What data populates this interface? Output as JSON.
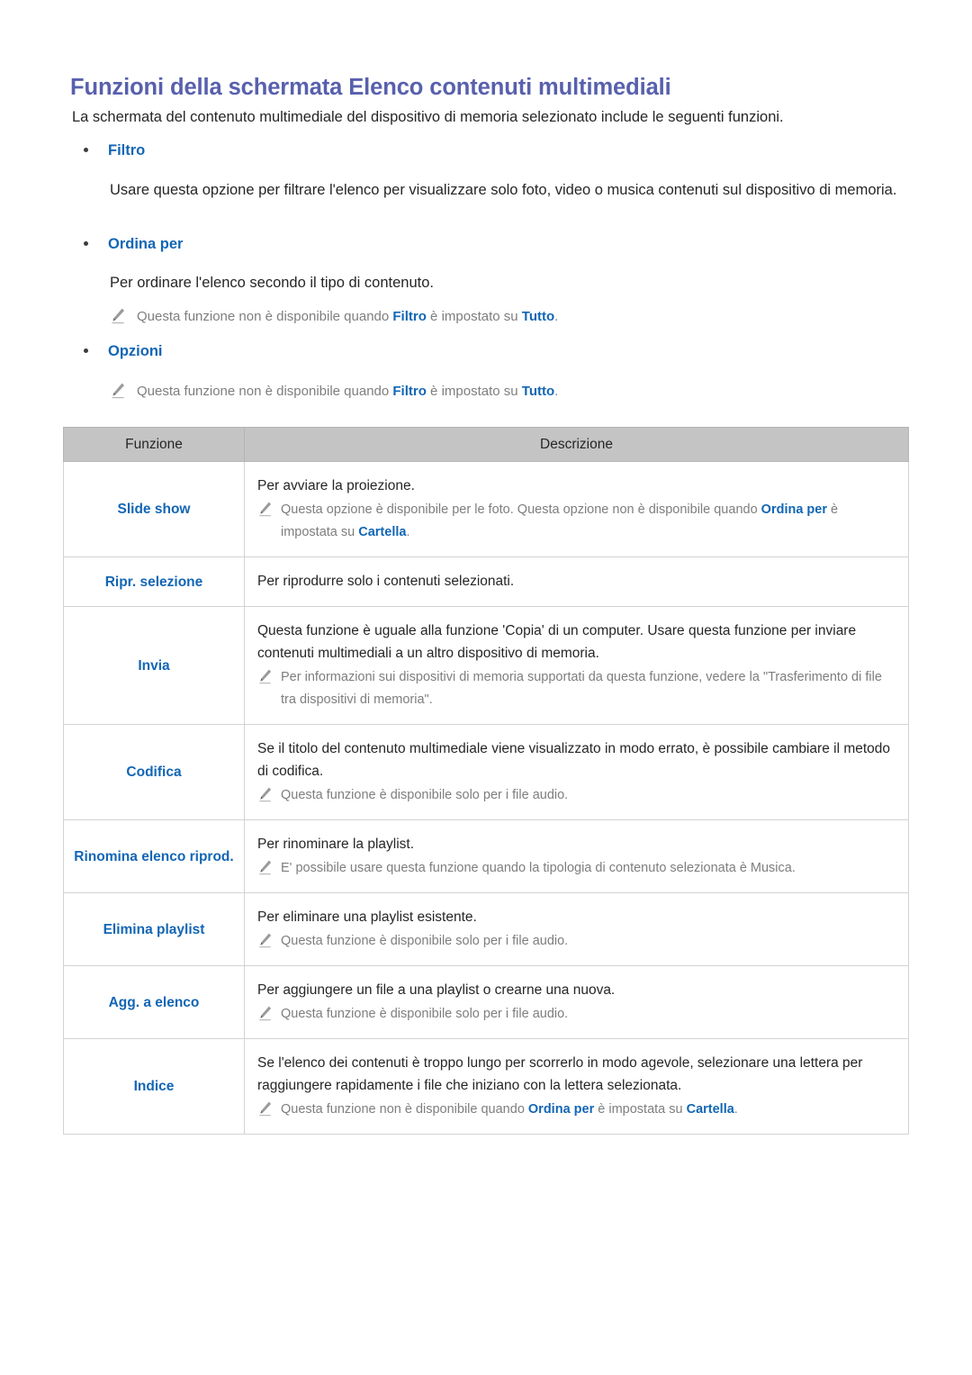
{
  "document": {
    "title": "Funzioni della schermata Elenco contenuti multimediali",
    "intro": "La schermata del contenuto multimediale del dispositivo di memoria selezionato include le seguenti funzioni."
  },
  "colors": {
    "title": "#5860ad",
    "accent_blue": "#1266b5",
    "note_gray": "#7e7e7e",
    "table_header_bg": "#c4c4c4",
    "border": "#d3d3d3"
  },
  "sections": [
    {
      "heading": "Filtro",
      "body": "Usare questa opzione per filtrare l'elenco per visualizzare solo foto, video o musica contenuti sul dispositivo di memoria.",
      "notes": []
    },
    {
      "heading": "Ordina per",
      "body": "Per ordinare l'elenco secondo il tipo di contenuto.",
      "notes": [
        {
          "icon": "pencil-icon",
          "pre": "Questa funzione non è disponibile quando ",
          "bold1": "Filtro",
          "mid": " è impostato su ",
          "bold2": "Tutto",
          "post": "."
        }
      ]
    },
    {
      "heading": "Opzioni",
      "body": "",
      "notes": [
        {
          "icon": "pencil-icon",
          "pre": "Questa funzione non è disponibile quando ",
          "bold1": "Filtro",
          "mid": " è impostato su ",
          "bold2": "Tutto",
          "post": "."
        }
      ]
    }
  ],
  "table": {
    "headers": [
      "Funzione",
      "Descrizione"
    ],
    "rows": [
      {
        "function": "Slide show",
        "lines": [
          "Per avviare la proiezione."
        ],
        "note": {
          "icon": "pencil-icon",
          "pre": "Questa opzione è disponibile per le foto. Questa opzione non è disponibile quando ",
          "bold1": "Ordina per",
          "mid": " è impostata su ",
          "bold2": "Cartella",
          "post": "."
        }
      },
      {
        "function": "Ripr. selezione",
        "lines": [
          "Per riprodurre solo i contenuti selezionati."
        ],
        "note": null
      },
      {
        "function": "Invia",
        "lines": [
          "Questa funzione è uguale alla funzione 'Copia' di un computer. Usare questa funzione per inviare contenuti multimediali a un altro dispositivo di memoria."
        ],
        "note": {
          "icon": "pencil-icon",
          "pre": "Per informazioni sui dispositivi di memoria supportati da questa funzione, vedere la \"Trasferimento di file tra dispositivi di memoria\".",
          "bold1": "",
          "mid": "",
          "bold2": "",
          "post": ""
        }
      },
      {
        "function": "Codifica",
        "lines": [
          "Se il titolo del contenuto multimediale viene visualizzato in modo errato, è possibile cambiare il metodo di codifica."
        ],
        "note": {
          "icon": "pencil-icon",
          "pre": "Questa funzione è disponibile solo per i file audio.",
          "bold1": "",
          "mid": "",
          "bold2": "",
          "post": ""
        }
      },
      {
        "function": "Rinomina elenco riprod.",
        "lines": [
          "Per rinominare la playlist."
        ],
        "note": {
          "icon": "pencil-icon",
          "pre": "E' possibile usare questa funzione quando la tipologia di contenuto selezionata è Musica.",
          "bold1": "",
          "mid": "",
          "bold2": "",
          "post": ""
        }
      },
      {
        "function": "Elimina playlist",
        "lines": [
          "Per eliminare una playlist esistente."
        ],
        "note": {
          "icon": "pencil-icon",
          "pre": "Questa funzione è disponibile solo per i file audio.",
          "bold1": "",
          "mid": "",
          "bold2": "",
          "post": ""
        }
      },
      {
        "function": "Agg. a elenco",
        "lines": [
          "Per aggiungere un file a una playlist o crearne una nuova."
        ],
        "note": {
          "icon": "pencil-icon",
          "pre": "Questa funzione è disponibile solo per i file audio.",
          "bold1": "",
          "mid": "",
          "bold2": "",
          "post": ""
        }
      },
      {
        "function": "Indice",
        "lines": [
          "Se l'elenco dei contenuti è troppo lungo per scorrerlo in modo agevole, selezionare una lettera per raggiungere rapidamente i file che iniziano con la lettera selezionata."
        ],
        "note": {
          "icon": "pencil-icon",
          "pre": "Questa funzione non è disponibile quando ",
          "bold1": "Ordina per",
          "mid": " è impostata su ",
          "bold2": "Cartella",
          "post": "."
        }
      }
    ]
  }
}
